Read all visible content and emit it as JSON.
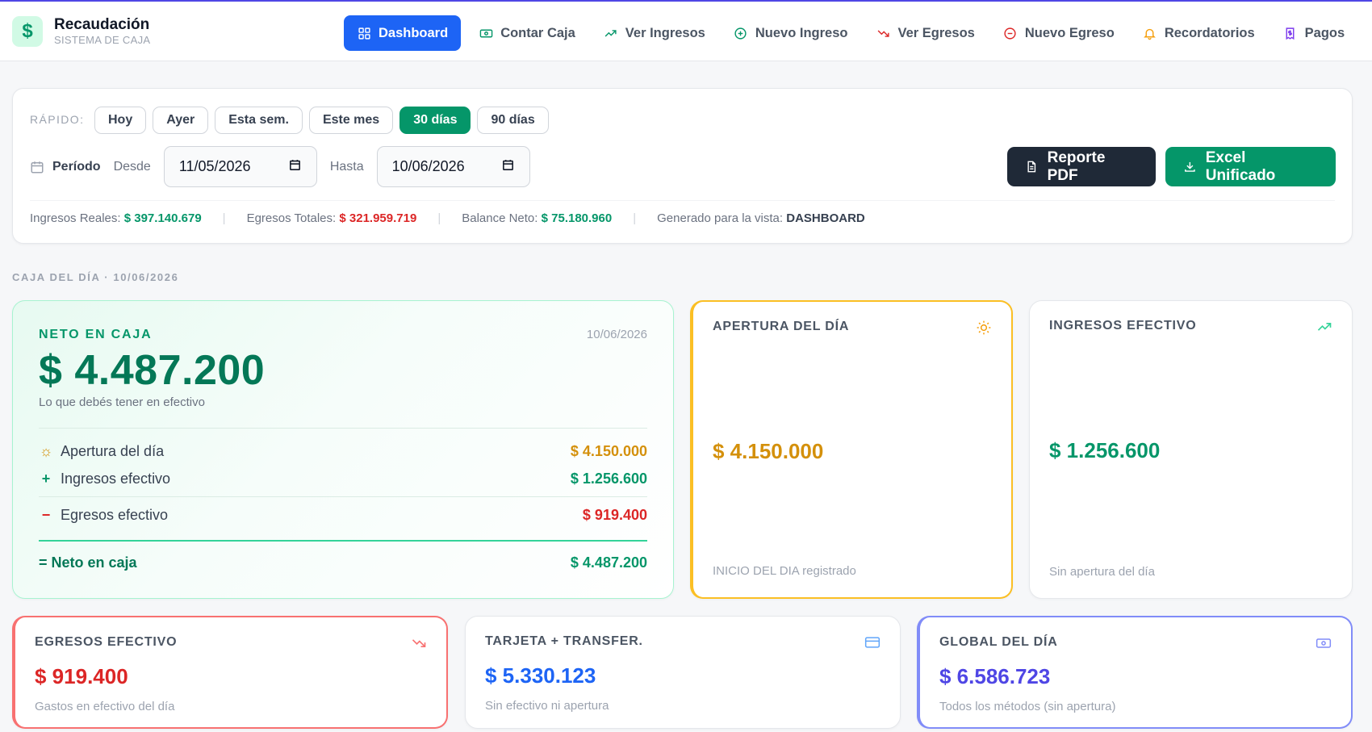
{
  "brand": {
    "title": "Recaudación",
    "subtitle": "SISTEMA DE CAJA",
    "logo_symbol": "$"
  },
  "nav": [
    {
      "label": "Dashboard",
      "icon": "grid-icon",
      "active": true
    },
    {
      "label": "Contar Caja",
      "icon": "cash-icon"
    },
    {
      "label": "Ver Ingresos",
      "icon": "trending-up-icon"
    },
    {
      "label": "Nuevo Ingreso",
      "icon": "plus-circle-icon"
    },
    {
      "label": "Ver Egresos",
      "icon": "trending-down-icon"
    },
    {
      "label": "Nuevo Egreso",
      "icon": "minus-circle-icon"
    },
    {
      "label": "Recordatorios",
      "icon": "bell-icon"
    },
    {
      "label": "Pagos",
      "icon": "receipt-icon"
    }
  ],
  "filters": {
    "quick_label": "RÁPIDO:",
    "chips": [
      "Hoy",
      "Ayer",
      "Esta sem.",
      "Este mes",
      "30 días",
      "90 días"
    ],
    "active_chip": "30 días",
    "period_label": "Período",
    "from_label": "Desde",
    "from_value": "11/05/2026",
    "to_label": "Hasta",
    "to_value": "10/06/2026",
    "pdf_button": "Reporte PDF",
    "excel_button": "Excel Unificado",
    "summary": {
      "income_label": "Ingresos Reales:",
      "income_value": "$ 397.140.679",
      "expense_label": "Egresos Totales:",
      "expense_value": "$ 321.959.719",
      "balance_label": "Balance Neto:",
      "balance_value": "$ 75.180.960",
      "generated_label": "Generado para la vista:",
      "generated_value": "DASHBOARD",
      "separator": "|"
    }
  },
  "section_title": "CAJA DEL DÍA · 10/06/2026",
  "neto": {
    "label": "NETO EN CAJA",
    "date": "10/06/2026",
    "amount": "$ 4.487.200",
    "hint": "Lo que debés tener en efectivo",
    "rows": [
      {
        "symbol": "☼",
        "label": "Apertura del día",
        "value": "$ 4.150.000"
      },
      {
        "symbol": "+",
        "label": "Ingresos efectivo",
        "value": "$ 1.256.600"
      },
      {
        "symbol": "−",
        "label": "Egresos efectivo",
        "value": "$ 919.400"
      }
    ],
    "total_label": "= Neto en caja",
    "total_value": "$ 4.487.200"
  },
  "cards": {
    "apertura": {
      "title": "APERTURA DEL DÍA",
      "amount": "$ 4.150.000",
      "foot": "INICIO DEL DIA registrado",
      "icon": "sun-icon",
      "color": "#d4900b"
    },
    "ingresos": {
      "title": "INGRESOS EFECTIVO",
      "amount": "$ 1.256.600",
      "foot": "Sin apertura del día",
      "icon": "trending-up-icon",
      "color": "#059669"
    },
    "egresos": {
      "title": "EGRESOS EFECTIVO",
      "amount": "$ 919.400",
      "foot": "Gastos en efectivo del día",
      "icon": "trending-down-icon",
      "color": "#dc2626"
    },
    "tarjeta": {
      "title": "TARJETA + TRANSFER.",
      "amount": "$ 5.330.123",
      "foot": "Sin efectivo ni apertura",
      "icon": "credit-card-icon",
      "color": "#1d64f5"
    },
    "global": {
      "title": "GLOBAL DEL DÍA",
      "amount": "$ 6.586.723",
      "foot": "Todos los métodos (sin apertura)",
      "icon": "banknote-icon",
      "color": "#4f46e5"
    }
  }
}
